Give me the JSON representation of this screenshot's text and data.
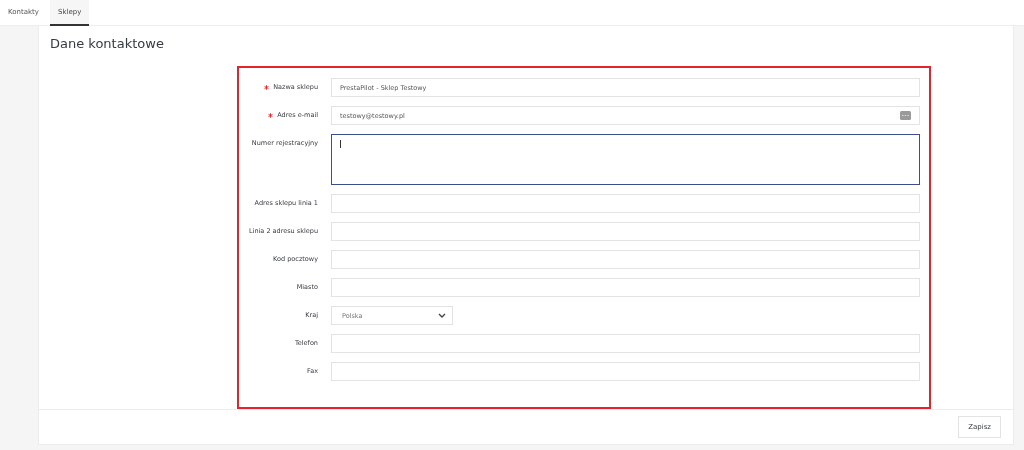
{
  "tabs": [
    {
      "label": "Kontakty",
      "selected": false
    },
    {
      "label": "Sklepy",
      "selected": true
    }
  ],
  "section_title": "Dane kontaktowe",
  "fields": [
    {
      "kind": "text",
      "label": "Nazwa sklepu",
      "required": true,
      "value": "PrestaPilot - Sklep Testowy",
      "focused": false
    },
    {
      "kind": "email",
      "label": "Adres e-mail",
      "required": true,
      "value": "testowy@testowy.pl",
      "focused": false
    },
    {
      "kind": "textarea",
      "label": "Numer rejestracyjny",
      "required": false,
      "focused": true
    },
    {
      "kind": "text",
      "label": "Adres sklepu linia 1",
      "required": false,
      "focused": false
    },
    {
      "kind": "text",
      "label": "Linia 2 adresu sklepu",
      "required": false,
      "focused": false
    },
    {
      "kind": "text",
      "label": "Kod pocztowy",
      "required": false,
      "focused": false
    },
    {
      "kind": "text",
      "label": "Miasto",
      "required": false,
      "focused": false
    },
    {
      "kind": "select",
      "label": "Kraj",
      "required": false,
      "value": "Polska"
    },
    {
      "kind": "text",
      "label": "Telefon",
      "required": false,
      "focused": false
    },
    {
      "kind": "text",
      "label": "Fax",
      "required": false,
      "focused": false
    }
  ],
  "save_button": "Zapisz"
}
